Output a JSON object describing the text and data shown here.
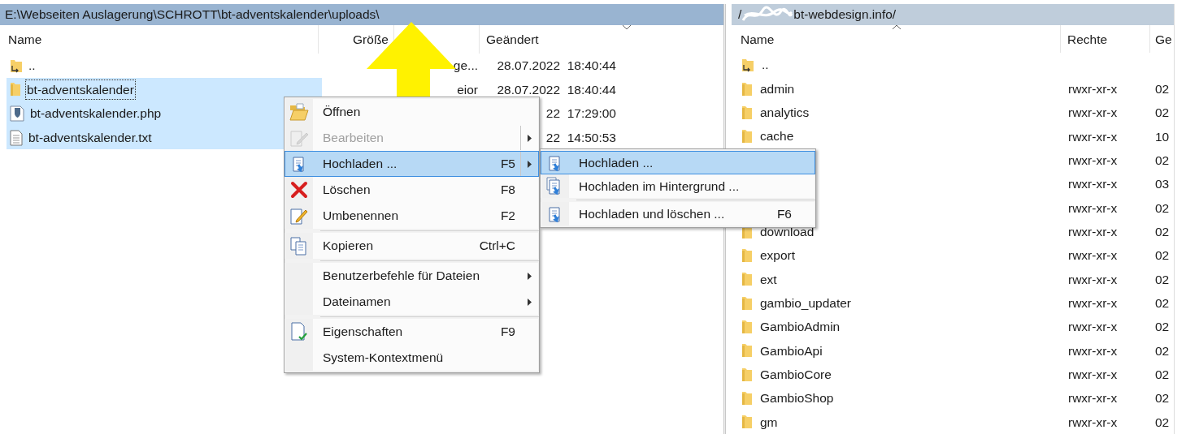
{
  "left_panel": {
    "path": "E:\\Webseiten Auslagerung\\SCHROTT\\bt-adventskalender\\uploads\\",
    "active": true,
    "columns": [
      "Name",
      "Größe",
      "Geändert"
    ],
    "rows": [
      {
        "kind": "parent",
        "name": "..",
        "column_3": "ge...",
        "modified": "28.07.2022  18:40:44",
        "selected": false,
        "focused": false
      },
      {
        "kind": "folder",
        "name": "bt-adventskalender",
        "column_3": "eior",
        "modified": "28.07.2022  18:40:44",
        "selected": true,
        "focused": true
      },
      {
        "kind": "php",
        "name": "bt-adventskalender.php",
        "modified": "22  17:29:00",
        "selected": true,
        "focused": false
      },
      {
        "kind": "text",
        "name": "bt-adventskalender.txt",
        "modified": "22  14:50:53",
        "selected": true,
        "focused": false
      }
    ]
  },
  "right_panel": {
    "path_start": "/",
    "path_end": "bt-webdesign.info/",
    "active": false,
    "columns": [
      "Name",
      "Rechte",
      "Ge"
    ],
    "rows": [
      {
        "kind": "parent",
        "name": ".."
      },
      {
        "kind": "folder",
        "name": "admin",
        "rights": "rwxr-xr-x",
        "column_3": "02"
      },
      {
        "kind": "folder",
        "name": "analytics",
        "rights": "rwxr-xr-x",
        "column_3": "02"
      },
      {
        "kind": "folder",
        "name": "cache",
        "rights": "rwxr-xr-x",
        "column_3": "10"
      },
      {
        "rights": "rwxr-xr-x",
        "column_3": "02"
      },
      {
        "rights": "rwxr-xr-x",
        "column_3": "03"
      },
      {
        "rights": "rwxr-xr-x",
        "column_3": "02"
      },
      {
        "kind": "folder",
        "name": "download",
        "rights": "rwxr-xr-x",
        "column_3": "02"
      },
      {
        "kind": "folder",
        "name": "export",
        "rights": "rwxr-xr-x",
        "column_3": "02"
      },
      {
        "kind": "folder",
        "name": "ext",
        "rights": "rwxr-xr-x",
        "column_3": "02"
      },
      {
        "kind": "folder",
        "name": "gambio_updater",
        "rights": "rwxr-xr-x",
        "column_3": "02"
      },
      {
        "kind": "folder",
        "name": "GambioAdmin",
        "rights": "rwxr-xr-x",
        "column_3": "02"
      },
      {
        "kind": "folder",
        "name": "GambioApi",
        "rights": "rwxr-xr-x",
        "column_3": "02"
      },
      {
        "kind": "folder",
        "name": "GambioCore",
        "rights": "rwxr-xr-x",
        "column_3": "02"
      },
      {
        "kind": "folder",
        "name": "GambioShop",
        "rights": "rwxr-xr-x",
        "column_3": "02"
      },
      {
        "kind": "folder",
        "name": "gm",
        "rights": "rwxr-xr-x",
        "column_3": "02"
      }
    ]
  },
  "context_menu": {
    "items": [
      {
        "kind": "item",
        "label": "Öffnen",
        "selected": false,
        "disabled": false,
        "submenu": false
      },
      {
        "kind": "item",
        "label": "Bearbeiten",
        "selected": false,
        "disabled": true,
        "submenu": true
      },
      {
        "kind": "item",
        "label": "Hochladen ...",
        "shortcut": "F5",
        "selected": true,
        "disabled": false,
        "submenu": true
      },
      {
        "kind": "item",
        "label": "Löschen",
        "shortcut": "F8",
        "selected": false,
        "disabled": false,
        "submenu": false
      },
      {
        "kind": "item",
        "label": "Umbenennen",
        "shortcut": "F2",
        "selected": false,
        "disabled": false,
        "submenu": false
      },
      {
        "kind": "separator"
      },
      {
        "kind": "item",
        "label": "Kopieren",
        "shortcut": "Ctrl+C",
        "selected": false,
        "disabled": false,
        "submenu": false
      },
      {
        "kind": "separator"
      },
      {
        "kind": "item",
        "label": "Benutzerbefehle für Dateien",
        "selected": false,
        "disabled": false,
        "submenu": true
      },
      {
        "kind": "item",
        "label": "Dateinamen",
        "selected": false,
        "disabled": false,
        "submenu": true
      },
      {
        "kind": "separator"
      },
      {
        "kind": "item",
        "label": "Eigenschaften",
        "shortcut": "F9",
        "selected": false,
        "disabled": false,
        "submenu": false
      },
      {
        "kind": "item",
        "label": "System-Kontextmenü",
        "selected": false,
        "disabled": false,
        "submenu": false
      }
    ]
  },
  "submenu": {
    "items": [
      {
        "kind": "item",
        "label": "Hochladen ...",
        "selected": true
      },
      {
        "kind": "item",
        "label": "Hochladen im Hintergrund ...",
        "selected": false
      },
      {
        "kind": "separator"
      },
      {
        "kind": "item",
        "label": "Hochladen und löschen ...",
        "shortcut": "F6",
        "selected": false
      }
    ]
  }
}
